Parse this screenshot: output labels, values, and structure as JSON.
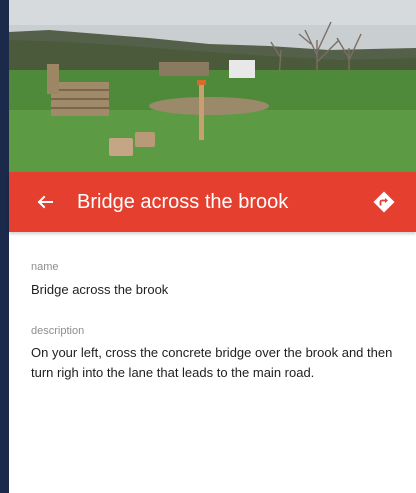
{
  "header": {
    "title": "Bridge across the brook",
    "back_icon": "arrow-left-icon",
    "directions_icon": "directions-icon"
  },
  "photo": {
    "subject": "grassy field with wooden pallets, a post and logs"
  },
  "details": {
    "name_label": "name",
    "name_value": "Bridge across the brook",
    "description_label": "description",
    "description_value": "On your left, cross the concrete bridge over the brook and then turn righ into the lane that leads to the main road."
  },
  "colors": {
    "appbar": "#e53f2f",
    "left_strip": "#1b2a4a",
    "label": "#8e8e8e",
    "text": "#1f1f1f"
  }
}
